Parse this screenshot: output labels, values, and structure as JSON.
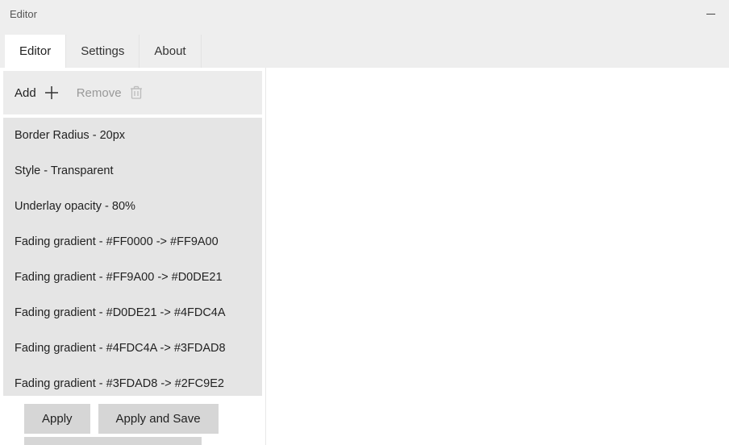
{
  "window": {
    "title": "Editor"
  },
  "tabs": [
    {
      "label": "Editor",
      "active": true
    },
    {
      "label": "Settings",
      "active": false
    },
    {
      "label": "About",
      "active": false
    }
  ],
  "toolbar": {
    "add_label": "Add",
    "remove_label": "Remove"
  },
  "list_items": [
    "Border Radius - 20px",
    "Style - Transparent",
    "Underlay opacity - 80%",
    "Fading gradient - #FF0000 -> #FF9A00",
    "Fading gradient - #FF9A00 -> #D0DE21",
    "Fading gradient - #D0DE21 -> #4FDC4A",
    "Fading gradient - #4FDC4A -> #3FDAD8",
    "Fading gradient - #3FDAD8 -> #2FC9E2"
  ],
  "buttons": {
    "apply": "Apply",
    "apply_save": "Apply and Save"
  }
}
